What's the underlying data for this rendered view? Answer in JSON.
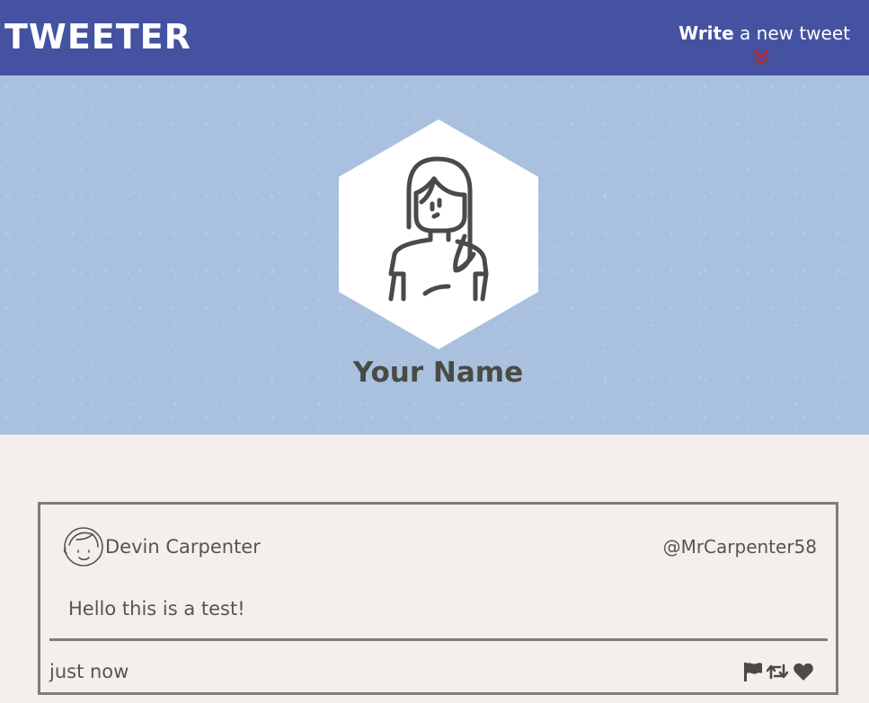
{
  "nav": {
    "logo": "TWEETER",
    "compose_bold": "Write",
    "compose_rest": " a new tweet",
    "compose_icon": "double-chevron-down-icon",
    "compose_icon_color": "#c0262d"
  },
  "profile": {
    "name": "Your Name",
    "avatar_icon": "woman-avatar-icon"
  },
  "colors": {
    "navbar": "#4452a1",
    "header": "#a9c0df",
    "page_background": "#f3f0eb",
    "text": "#55554f",
    "border": "#7d7d7d"
  },
  "tweets": [
    {
      "author_name": "Devin Carpenter",
      "handle": "@MrCarpenter58",
      "avatar_icon": "man-avatar-icon",
      "body": "Hello this is a test!",
      "timestamp": "just now",
      "actions": [
        "flag-icon",
        "retweet-icon",
        "heart-icon"
      ]
    }
  ]
}
